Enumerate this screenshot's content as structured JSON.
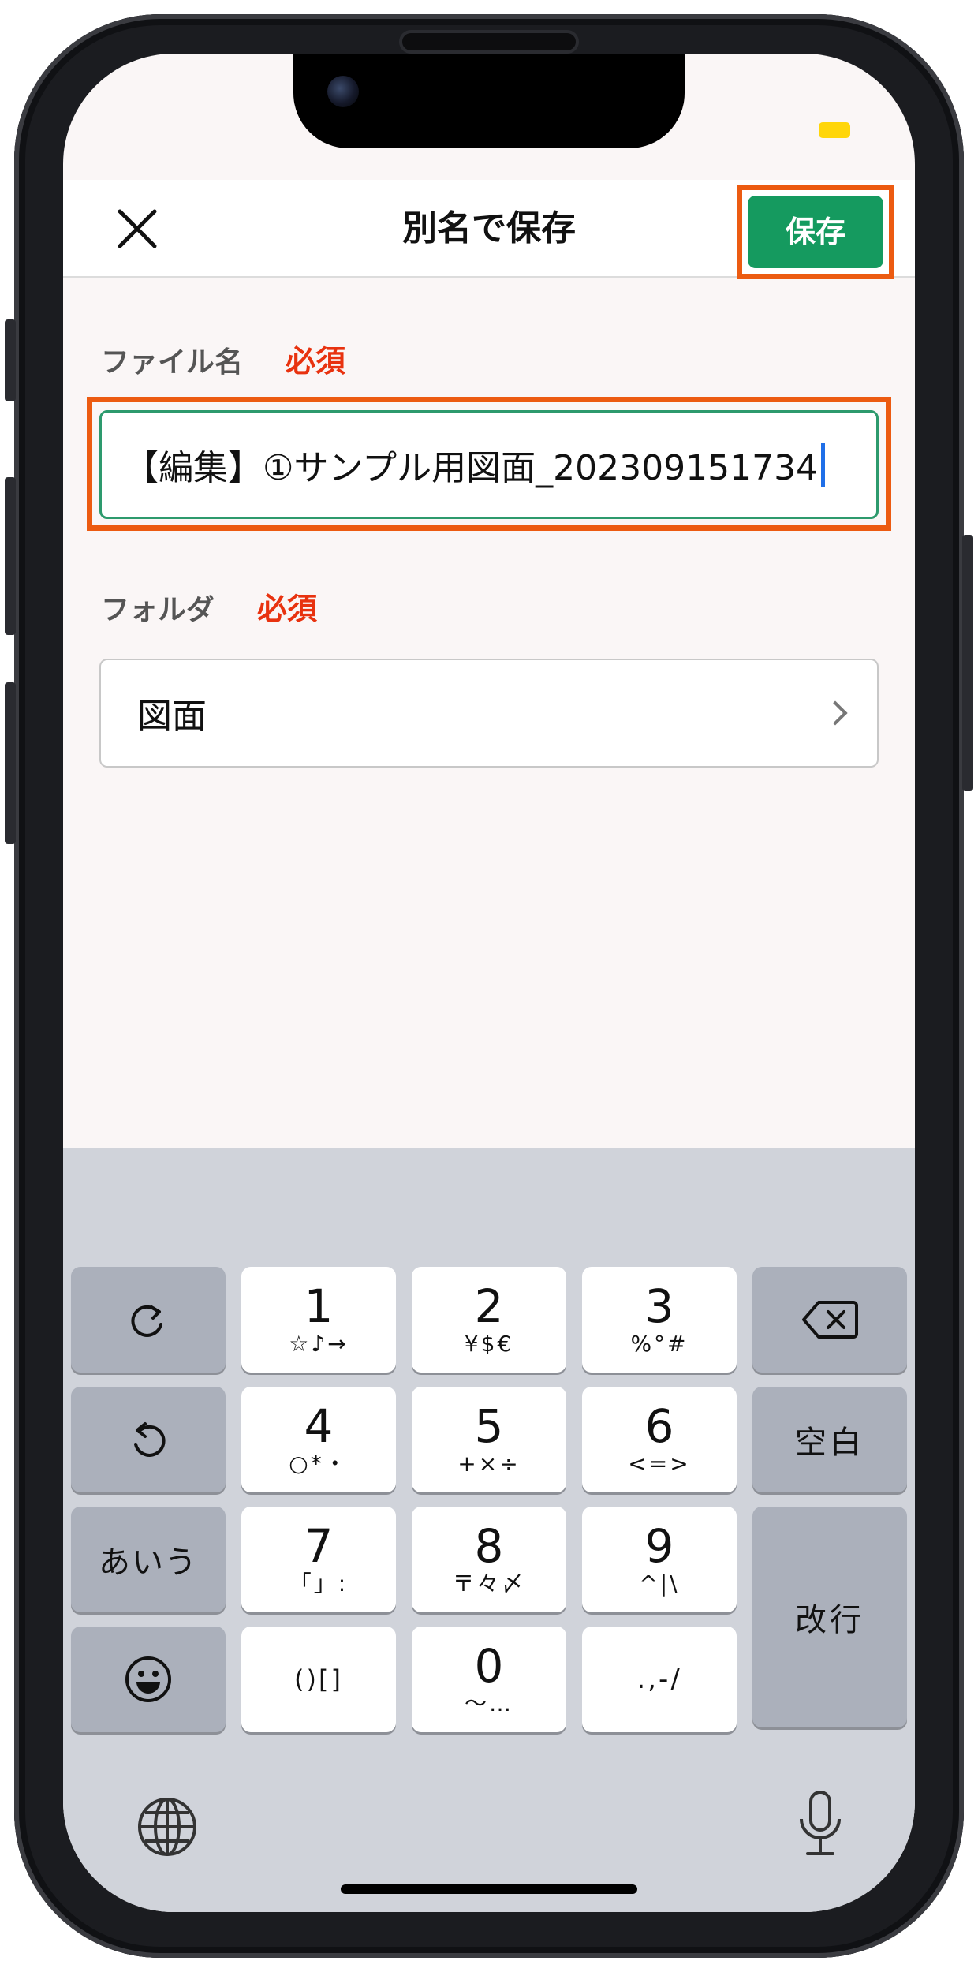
{
  "nav": {
    "title": "別名で保存",
    "save_label": "保存"
  },
  "form": {
    "filename_label": "ファイル名",
    "filename_required": "必須",
    "filename_value": "【編集】①サンプル用図面_202309151734",
    "folder_label": "フォルダ",
    "folder_required": "必須",
    "folder_value": "図面"
  },
  "keyboard": {
    "keys": [
      {
        "main": "1",
        "sub": "☆♪→"
      },
      {
        "main": "2",
        "sub": "¥$€"
      },
      {
        "main": "3",
        "sub": "%°#"
      },
      {
        "main": "4",
        "sub": "○*・"
      },
      {
        "main": "5",
        "sub": "+×÷"
      },
      {
        "main": "6",
        "sub": "<=>"
      },
      {
        "main": "7",
        "sub": "「」:"
      },
      {
        "main": "8",
        "sub": "〒々〆"
      },
      {
        "main": "9",
        "sub": "^|\\"
      },
      {
        "main": "()[]",
        "sub": ""
      },
      {
        "main": "0",
        "sub": "〜…"
      },
      {
        "main": ".,-/",
        "sub": ""
      }
    ],
    "space_label": "空白",
    "enter_label": "改行",
    "kana_label": "あいう"
  },
  "colors": {
    "accent": "#159a5f",
    "highlight": "#ec5b11",
    "required": "#e8320f",
    "caret": "#1f6fe8"
  },
  "icons": {
    "close": "close-icon",
    "redo": "redo-icon",
    "undo": "undo-icon",
    "backspace": "backspace-icon",
    "emoji": "emoji-icon",
    "globe": "globe-icon",
    "mic": "microphone-icon",
    "chevron": "chevron-right-icon"
  }
}
